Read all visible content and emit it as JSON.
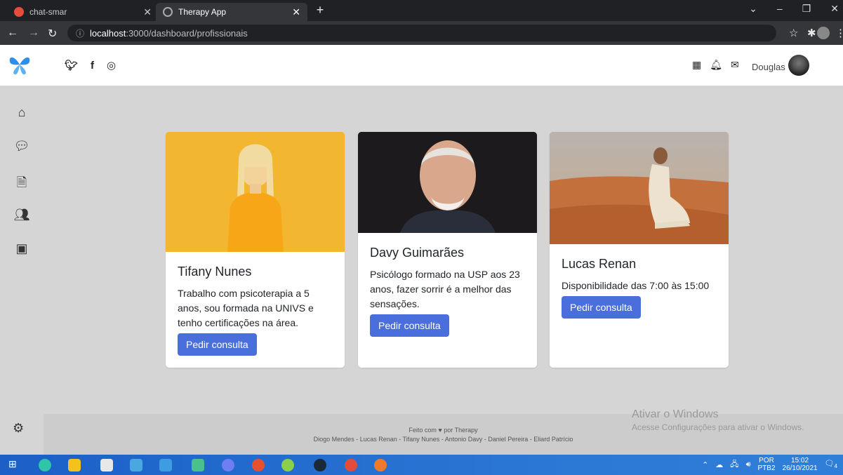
{
  "browser": {
    "tabs": [
      {
        "title": "chat-smar",
        "active": false
      },
      {
        "title": "Therapy App",
        "active": true
      }
    ],
    "url_host": "localhost",
    "url_rest": ":3000/dashboard/profissionais"
  },
  "header": {
    "user_name": "Douglas"
  },
  "cards": [
    {
      "name": "Tifany Nunes",
      "description": "Trabalho com psicoterapia a 5 anos, sou formada na UNIVS e tenho certificações na área.",
      "button": "Pedir consulta"
    },
    {
      "name": "Davy Guimarães",
      "description": "Psicólogo formado na USP aos 23 anos, fazer sorrir é a melhor das sensações.",
      "button": "Pedir consulta"
    },
    {
      "name": "Lucas Renan",
      "description": "Disponibilidade das 7:00 às 15:00",
      "button": "Pedir consulta"
    }
  ],
  "footer": {
    "line1": "Feito com ♥ por Therapy",
    "line2": "Diogo Mendes - Lucas Renan - Tifany Nunes - Antonio Davy - Daniel Pereira - Eliard Patrício"
  },
  "watermark": {
    "title": "Ativar o Windows",
    "subtitle": "Acesse Configurações para ativar o Windows."
  },
  "taskbar": {
    "lang": "POR",
    "kbd": "PTB2",
    "time": "15:02",
    "date": "26/10/2021",
    "notifications": "4"
  },
  "colors": {
    "accent": "#4a6fdc",
    "content_bg": "#d5d5d5"
  }
}
